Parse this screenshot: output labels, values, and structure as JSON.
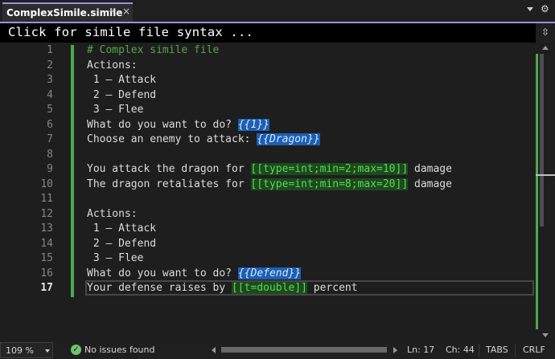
{
  "tab": {
    "title": "ComplexSimile.simile",
    "pin_icon": "pin-icon",
    "close_icon": "close-icon",
    "close_glyph": "×"
  },
  "toolbar": {
    "dropdown_icon": "chevron-down-icon",
    "settings_icon": "gear-icon",
    "settings_glyph": "⚙"
  },
  "infobar": {
    "text": "Click for simile file syntax ...",
    "split_glyph": "⇳"
  },
  "editor": {
    "active_line": 17,
    "lines": [
      {
        "num": "1",
        "text": "# Complex simile file",
        "type": "comment"
      },
      {
        "num": "2",
        "text": "Actions:"
      },
      {
        "num": "3",
        "text": " 1 – Attack"
      },
      {
        "num": "4",
        "text": " 2 – Defend"
      },
      {
        "num": "5",
        "text": " 3 – Flee"
      },
      {
        "num": "6",
        "pre": "What do you want to do? ",
        "blue": "{{1}}"
      },
      {
        "num": "7",
        "pre": "Choose an enemy to attack: ",
        "blue": "{{Dragon}}"
      },
      {
        "num": "8",
        "text": ""
      },
      {
        "num": "9",
        "pre": "You attack the dragon for ",
        "green": "[[type=int;min=2;max=10]]",
        "post": " damage"
      },
      {
        "num": "10",
        "pre": "The dragon retaliates for ",
        "green": "[[type=int;min=8;max=20]]",
        "post": " damage"
      },
      {
        "num": "11",
        "text": ""
      },
      {
        "num": "12",
        "text": "Actions:"
      },
      {
        "num": "13",
        "text": " 1 – Attack"
      },
      {
        "num": "14",
        "text": " 2 – Defend"
      },
      {
        "num": "15",
        "text": " 3 – Flee"
      },
      {
        "num": "16",
        "pre": "What do you want to do? ",
        "blue": "{{Defend}}"
      },
      {
        "num": "17",
        "pre": "Your defense raises by ",
        "green": "[[t=double]]",
        "post": " percent"
      }
    ]
  },
  "statusbar": {
    "zoom": "109 %",
    "issues": "No issues found",
    "line": "Ln: 17",
    "col": "Ch: 44",
    "indent": "TABS",
    "eol": "CRLF"
  },
  "colors": {
    "accent": "#a08fe8",
    "change_bar": "#4ea94e",
    "highlight_blue": "#1c5fb3",
    "highlight_green": "#1d4a1d",
    "comment": "#57a64a"
  }
}
